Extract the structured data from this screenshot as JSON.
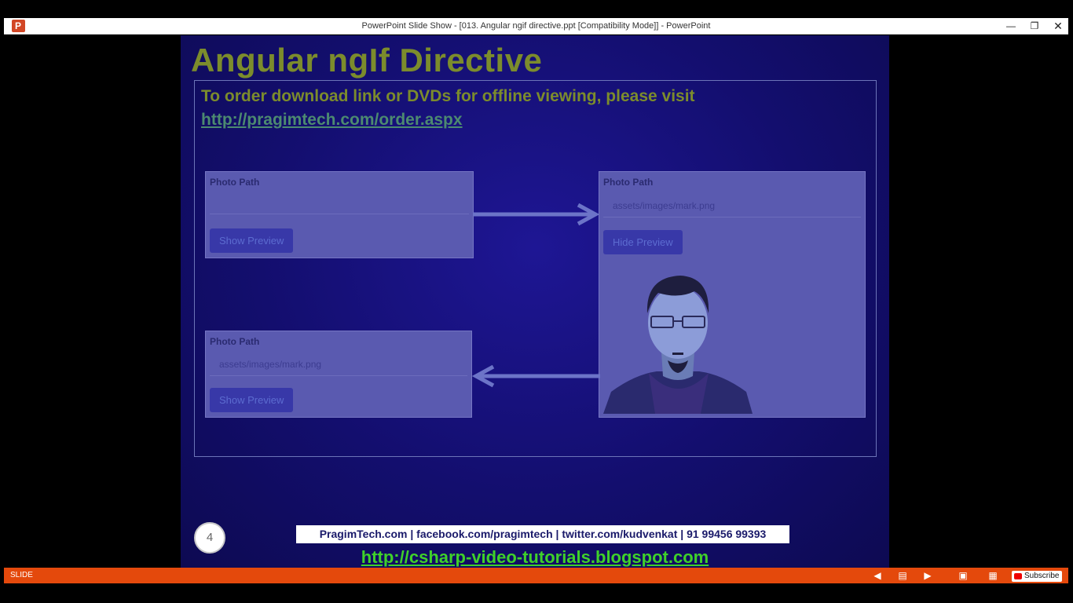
{
  "window": {
    "title": "PowerPoint Slide Show - [013. Angular ngif directive.ppt [Compatibility Mode]] - PowerPoint",
    "minimize_glyph": "—",
    "restore_glyph": "❐",
    "close_glyph": "✕"
  },
  "slide": {
    "title": "Angular ngIf Directive",
    "order_text": "To order download link or DVDs for offline viewing, please visit",
    "order_link": "http://pragimtech.com/order.aspx",
    "panel_top_left": {
      "label": "Photo Path",
      "input_value": "",
      "button": "Show Preview"
    },
    "panel_right": {
      "label": "Photo Path",
      "input_value": "assets/images/mark.png",
      "button": "Hide Preview"
    },
    "panel_bottom_left": {
      "label": "Photo Path",
      "input_value": "assets/images/mark.png",
      "button": "Show Preview"
    },
    "page_number": "4",
    "contact_bar": "PragimTech.com | facebook.com/pragimtech | twitter.com/kudvenkat | 91 99456 99393",
    "blog_link": "http://csharp-video-tutorials.blogspot.com"
  },
  "statusbar": {
    "label": "SLIDE",
    "subscribe": "Subscribe",
    "accent_color": "#e4490c"
  },
  "icons": {
    "prev": "◀",
    "notes": "▤",
    "next": "▶",
    "normal_view": "▣",
    "grid_view": "▦"
  }
}
